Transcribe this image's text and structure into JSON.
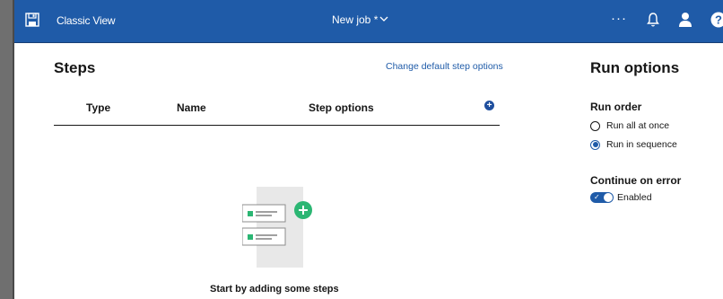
{
  "topbar": {
    "save_icon": "save-icon",
    "classic_view": "Classic View",
    "job_name": "New job *",
    "more": "···",
    "bell_icon": "bell-icon",
    "user_icon": "user-icon",
    "help_icon": "help-icon"
  },
  "steps": {
    "title": "Steps",
    "change_link": "Change default step options",
    "columns": [
      "Type",
      "Name",
      "Step options"
    ],
    "add_icon": "add-icon",
    "empty_message": "Start by adding some steps"
  },
  "run_options": {
    "title": "Run options",
    "order_label": "Run order",
    "order_options": [
      "Run all at once",
      "Run in sequence"
    ],
    "selected_order": "Run in sequence",
    "error_label": "Continue on error",
    "toggle_state": "Enabled"
  },
  "colors": {
    "brand": "#1f5ba8",
    "accent_green": "#2bb673"
  }
}
